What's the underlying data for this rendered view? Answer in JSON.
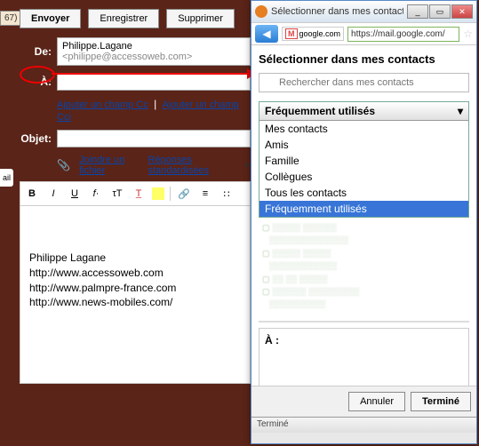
{
  "sidebar_count": "67)",
  "sidebar_tab": "ail",
  "compose": {
    "send": "Envoyer",
    "save": "Enregistrer",
    "delete": "Supprimer",
    "from_label": "De:",
    "from_value": "Philippe.Lagane",
    "from_email": "<philippe@accessoweb.com>",
    "to_label": "À:",
    "to_value": "",
    "add_cc": "Ajouter un champ Cc",
    "add_bcc": "Ajouter un champ Cci",
    "subject_label": "Objet:",
    "subject_value": "",
    "attach": "Joindre un fichier",
    "canned": "Réponses standardisées",
    "signature": {
      "name": "Philippe Lagane",
      "url1": "http://www.accessoweb.com",
      "url2": "http://www.palmpre-france.com",
      "url3": "http://www.news-mobiles.com/"
    }
  },
  "popup": {
    "window_title": "Sélectionner dans mes contacts - ...",
    "url_domain": "google.com",
    "url": "https://mail.google.com/",
    "heading": "Sélectionner dans mes contacts",
    "search_placeholder": "Rechercher dans mes contacts",
    "dropdown_selected": "Fréquemment utilisés",
    "options": [
      "Mes contacts",
      "Amis",
      "Famille",
      "Collègues",
      "Tous les contacts",
      "Fréquemment utilisés"
    ],
    "to_label": "À :",
    "cancel": "Annuler",
    "done": "Terminé",
    "status": "Terminé"
  }
}
